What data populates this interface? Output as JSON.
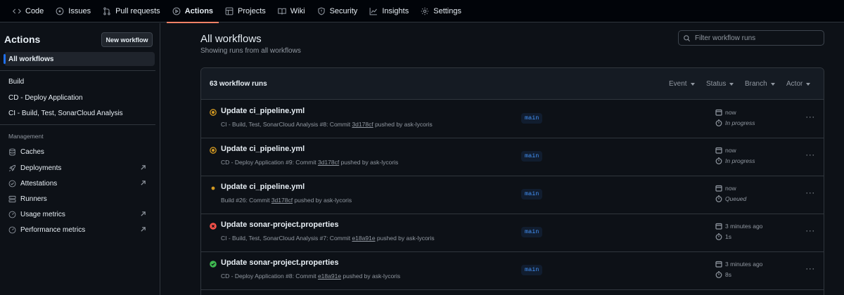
{
  "nav": {
    "tabs": [
      {
        "label": "Code",
        "icon": "code-icon"
      },
      {
        "label": "Issues",
        "icon": "issue-icon"
      },
      {
        "label": "Pull requests",
        "icon": "pull-request-icon"
      },
      {
        "label": "Actions",
        "icon": "play-icon",
        "active": true
      },
      {
        "label": "Projects",
        "icon": "table-icon"
      },
      {
        "label": "Wiki",
        "icon": "book-icon"
      },
      {
        "label": "Security",
        "icon": "shield-icon"
      },
      {
        "label": "Insights",
        "icon": "graph-icon"
      },
      {
        "label": "Settings",
        "icon": "gear-icon"
      }
    ],
    "active_color": "#f78166"
  },
  "sidebar": {
    "title": "Actions",
    "new_workflow": "New workflow",
    "all_workflows": "All workflows",
    "workflows": [
      "Build",
      "CD - Deploy Application",
      "CI - Build, Test, SonarCloud Analysis"
    ],
    "management_heading": "Management",
    "management": [
      {
        "label": "Caches",
        "icon": "database-icon",
        "external": false
      },
      {
        "label": "Deployments",
        "icon": "rocket-icon",
        "external": true
      },
      {
        "label": "Attestations",
        "icon": "check-circle-icon",
        "external": true
      },
      {
        "label": "Runners",
        "icon": "server-icon",
        "external": false
      },
      {
        "label": "Usage metrics",
        "icon": "meter-icon",
        "external": true
      },
      {
        "label": "Performance metrics",
        "icon": "meter-icon",
        "external": true
      }
    ]
  },
  "main": {
    "title": "All workflows",
    "subtitle": "Showing runs from all workflows",
    "filter_placeholder": "Filter workflow runs",
    "run_count": "63 workflow runs",
    "filters": [
      "Event",
      "Status",
      "Branch",
      "Actor"
    ],
    "runs": [
      {
        "status": "in_progress",
        "title": "Update ci_pipeline.yml",
        "meta_prefix": "CI - Build, Test, SonarCloud Analysis #8: Commit ",
        "commit": "3d178cf",
        "meta_suffix": " pushed by ask-lycoris",
        "branch": "main",
        "when": "now",
        "state": "In progress"
      },
      {
        "status": "in_progress",
        "title": "Update ci_pipeline.yml",
        "meta_prefix": "CD - Deploy Application #9: Commit ",
        "commit": "3d178cf",
        "meta_suffix": " pushed by ask-lycoris",
        "branch": "main",
        "when": "now",
        "state": "In progress"
      },
      {
        "status": "queued",
        "title": "Update ci_pipeline.yml",
        "meta_prefix": "Build #26: Commit ",
        "commit": "3d178cf",
        "meta_suffix": " pushed by ask-lycoris",
        "branch": "main",
        "when": "now",
        "state": "Queued"
      },
      {
        "status": "failure",
        "title": "Update sonar-project.properties",
        "meta_prefix": "CI - Build, Test, SonarCloud Analysis #7: Commit ",
        "commit": "e18a91e",
        "meta_suffix": " pushed by ask-lycoris",
        "branch": "main",
        "when": "3 minutes ago",
        "state": "1s"
      },
      {
        "status": "success",
        "title": "Update sonar-project.properties",
        "meta_prefix": "CD - Deploy Application #8: Commit ",
        "commit": "e18a91e",
        "meta_suffix": " pushed by ask-lycoris",
        "branch": "main",
        "when": "3 minutes ago",
        "state": "8s"
      }
    ],
    "status_colors": {
      "in_progress": "#d29922",
      "queued": "#d29922",
      "failure": "#f85149",
      "success": "#3fb950"
    }
  }
}
